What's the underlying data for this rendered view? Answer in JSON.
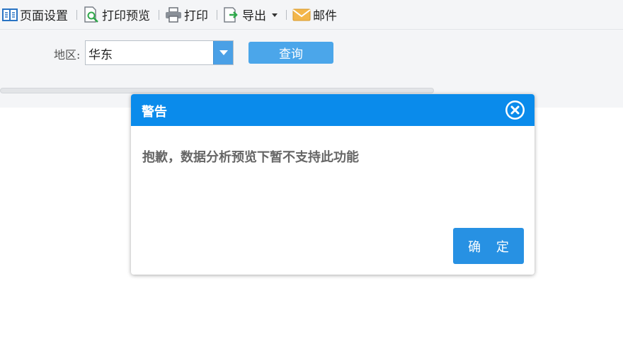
{
  "toolbar": {
    "items": [
      {
        "label": "页面设置",
        "icon": "page-setup-icon"
      },
      {
        "label": "打印预览",
        "icon": "print-preview-icon"
      },
      {
        "label": "打印",
        "icon": "printer-icon"
      },
      {
        "label": "导出",
        "icon": "export-icon"
      },
      {
        "label": "邮件",
        "icon": "mail-icon"
      }
    ]
  },
  "params": {
    "region_label": "地区:",
    "region_value": "华东",
    "query_label": "查询"
  },
  "dialog": {
    "title": "警告",
    "message": "抱歉，数据分析预览下暂不支持此功能",
    "ok_label": "确 定"
  },
  "colors": {
    "accent": "#0a8beb",
    "button": "#2791e3",
    "query_button": "#4ba6ea",
    "toolbar_bg": "#f4f5f7"
  }
}
